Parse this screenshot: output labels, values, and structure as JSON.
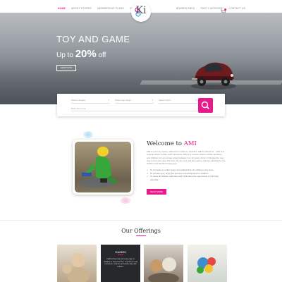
{
  "nav": {
    "left": [
      "HOME",
      "ABOUT STORES",
      "MEMBERSHIP PLANS",
      "PLAY & LEARN"
    ],
    "right": [
      "BRANDS AREA",
      "PARTY SERVICES",
      "CONTACT US"
    ],
    "active_index": 0,
    "logo_text": "Ki",
    "cart_count": "0"
  },
  "hero": {
    "title": "TOY AND GAME",
    "subtitle_prefix": "Up to",
    "subtitle_highlight": "20%",
    "subtitle_suffix": "off",
    "button": "SHOP NOW",
    "slides_total": 3,
    "slides_active": 1
  },
  "search": {
    "select1": "Select category",
    "select2": "Select age range",
    "select3": "Select brand",
    "input_placeholder": "Enter item here"
  },
  "welcome": {
    "title_plain": "Welcome to",
    "title_accent": "AMI",
    "text": "AMI is a fun toy stores, started from India on 1st 2017. AMI Ki stands for... AMI Ki is a group where to play, learn and grow. AMI Ki is a place where it holds members and children for toys of age group between 1 to 12 years. Aims in bringing the new way to hire and enjoy the toys. We are toys and also games that are pleasing for the children and families loving toys.",
    "list": [
      "To innovate a modern ways and relationship of a child to a toy store",
      "To provide toys, enjoy the process of development for children",
      "To value all children and help each child have the opportunity to fulfil their potential"
    ],
    "button": "READ MORE"
  },
  "offerings": {
    "title": "Our Offerings",
    "cards": [
      {
        "label": "",
        "desc": ""
      },
      {
        "label": "GAMES",
        "desc": "Dolls & Toys that suit every age of children to bring their fun, experience and excitement. Games and active play with children."
      },
      {
        "label": "",
        "desc": ""
      },
      {
        "label": "",
        "desc": ""
      }
    ]
  },
  "colors": {
    "accent": "#e8198b"
  }
}
